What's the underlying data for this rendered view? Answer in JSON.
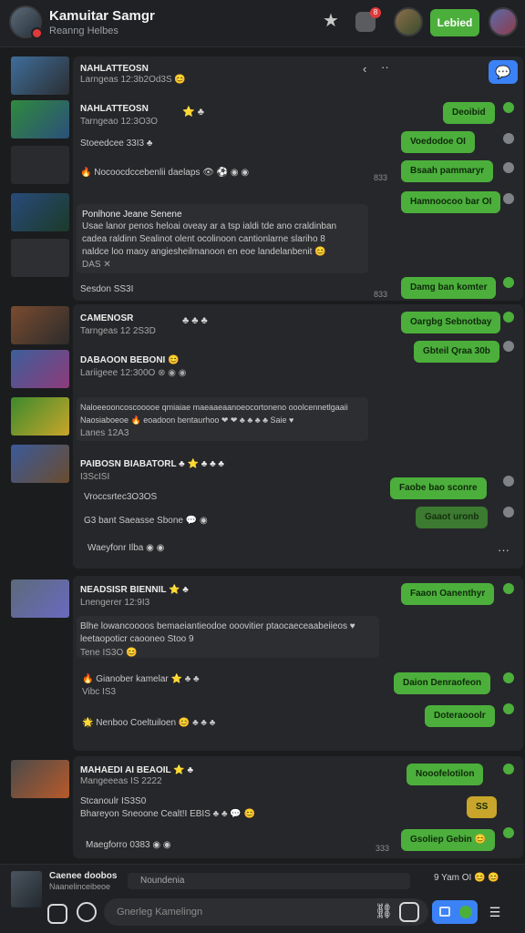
{
  "header": {
    "title": "Kamuitar Samgr",
    "subtitle": "Reanng Helbes",
    "notif_count": "8",
    "action_label": "Lebied"
  },
  "colors": {
    "accent_green": "#4caf3c",
    "accent_blue": "#3b82f6",
    "badge_red": "#e0393a"
  },
  "messages": [
    {
      "name": "NAHLATTEOSN",
      "meta": "Larngeas 12:3b2Od3S 😊"
    },
    {
      "name": "NAHLATTEOSN",
      "meta": "Tarngeao 12:3O3O",
      "emoji": "⭐ ♣"
    },
    {
      "line": "Stoeedcee 33I3 ♣"
    },
    {
      "line": "🔥 Nocoocdccebenlii daelaps 👁 ⚽ ◉ ◉",
      "ts": "833"
    },
    {
      "name": "Ponlhone Jeane Senene",
      "lines": [
        "Usae lanor penos heloai oveay ar a tsp ialdi tde ano craldinban",
        "cadea raldinn Sealinot olent ocolinoon cantionlarne slariho 8",
        "naldce loo maoy angiesheilmanoon en eoe landelanbenit 😊"
      ],
      "tag": "DAS ✕"
    },
    {
      "line": "Sesdon SS3I",
      "ts": "833"
    },
    {
      "name": "CAMENOSR",
      "meta": "Tarngeas 12 2S3D",
      "emoji": "♣ ♣ ♣"
    },
    {
      "name": "DABAOON BEBONI 😊",
      "meta": "Lariigeee 12:300O ⊗ ◉ ◉"
    },
    {
      "lines": [
        "Naloeeooncoscooooe qmiaiae maeaaeaanoeocortoneno ooolcennetlgaaii",
        "Naosiaboeoe 🔥 eoadoon bentaurhoo ❤ ❤ ♣ ♣ ♣ ♣ Saie ♥"
      ],
      "meta": "Lanes 12A3"
    },
    {
      "name": "PAIBOSN BIABATORL ♣ ⭐ ♣ ♣ ♣",
      "meta": "I3ScISI"
    },
    {
      "line": "Vroccsrtec3O3OS"
    },
    {
      "line": "G3 bant Saeasse Sbone 💬 ◉"
    },
    {
      "line": "Waeyfonr Ilba ◉ ◉"
    },
    {
      "name": "NEADSISR BIENNIL ⭐ ♣",
      "meta": "Lnengerer 12:9I3"
    },
    {
      "lines": [
        "Blhe lowancoooos bemaeiantieodoe ooovitier ptaocaeceaabeiieos ♥",
        "leetaopoticr caooneo Stoo 9"
      ],
      "meta": "Tene IS3O 😊"
    },
    {
      "line": "🔥 Gianober kamelar ⭐ ♣ ♣",
      "meta": "Vibc IS3"
    },
    {
      "line": "🌟 Nenboo Coeltuiloen 😊 ♣ ♣ ♣"
    },
    {
      "name": "MAHAEDI AI BEAOIL ⭐ ♣",
      "meta": "Mangeeeas IS 2222"
    },
    {
      "line": "Stcanoulr IS3S0",
      "line2": "Bhareyon Sneoone Cealt!I EBIS ♣ ♣ 💬 😊"
    },
    {
      "line": "Maegforro 0383 ◉ ◉",
      "ts": "333"
    }
  ],
  "bubbles": [
    "Deoibid",
    "Voedodoe OI",
    "Bsaah pammaryr",
    "Hamnoocoo bar OI",
    "Damg ban komter",
    "Oargbg Sebnotbay",
    "Gbteil Qraa 30b",
    "Faobe bao sconre",
    "Gaaot uronb",
    "Faaon Oanenthyr",
    "Daion Denraofeon",
    "Doteraooolr",
    "Nooofelotilon",
    "SS",
    "Gsoliep Gebin 😊"
  ],
  "composer": {
    "name": "Caenee doobos",
    "sub": "Naanelinceibeoe",
    "chip": "Noundenia",
    "right": "9 Yam OI 😊 😊",
    "placeholder": "Gnerleg Kamelingn"
  }
}
